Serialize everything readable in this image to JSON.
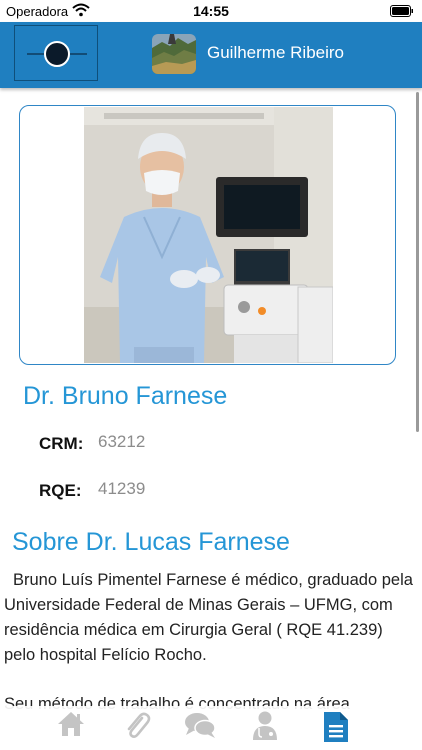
{
  "status_bar": {
    "carrier": "Operadora",
    "time": "14:55"
  },
  "header": {
    "user_name": "Guilherme Ribeiro",
    "accent_color": "#1f7fc0"
  },
  "doctor": {
    "name": "Dr. Bruno Farnese",
    "crm_label": "CRM:",
    "crm_value": "63212",
    "rqe_label": "RQE:",
    "rqe_value": "41239"
  },
  "about": {
    "title": "Sobre Dr. Lucas Farnese",
    "paragraph_1": "Bruno Luís Pimentel Farnese é médico, graduado pela Universidade Federal de Minas Gerais – UFMG, com residência médica em Cirurgia Geral ( RQE 41.239) pelo hospital Felício Rocho.",
    "paragraph_2": "Seu método de trabalho é concentrado na área"
  },
  "tabs": [
    {
      "icon": "home-icon",
      "active": false
    },
    {
      "icon": "paperclip-icon",
      "active": false
    },
    {
      "icon": "chat-bubbles-icon",
      "active": false
    },
    {
      "icon": "doctor-icon",
      "active": false
    },
    {
      "icon": "document-icon",
      "active": true
    }
  ],
  "colors": {
    "title_blue": "#2596d6",
    "tab_inactive": "#c4c4c4",
    "tab_active": "#1f7fc0"
  }
}
